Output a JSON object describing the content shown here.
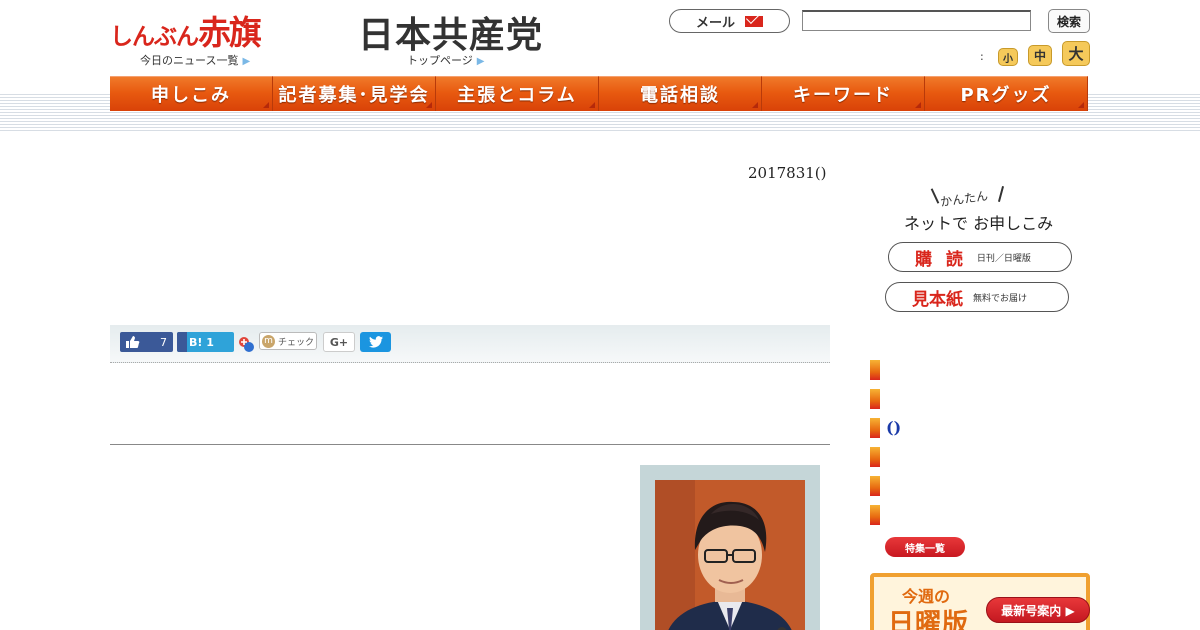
{
  "header": {
    "logo_small": "しんぶん",
    "logo_big": "赤旗",
    "party_logo": "日本共産党",
    "today_news_link": "今日のニュース一覧",
    "top_page_link": "トップページ",
    "mail_button": "メール",
    "search_input_value": "",
    "search_button": "検索",
    "font_size_label": ":",
    "font_small": "小",
    "font_medium": "中",
    "font_large": "大"
  },
  "nav": {
    "items": [
      "申しこみ",
      "記者募集･見学会",
      "主張とコラム",
      "電話相談",
      "キーワード",
      "PRグッズ"
    ]
  },
  "article": {
    "date": "2017831()"
  },
  "share": {
    "like_count": "7",
    "hatena_label": "B!",
    "hatena_count": "1",
    "mixi_label": "チェック",
    "gplus_label": "G+"
  },
  "sidebar": {
    "kantan": "かんたん",
    "net_signup": "ネットで お申しこみ",
    "subscribe_big": "購 読",
    "subscribe_sub": "日刊／日曜版",
    "sample_big": "見本紙",
    "sample_sub": "無料でお届け",
    "list_items": [
      "",
      "",
      "()",
      "",
      "",
      ""
    ],
    "features_button": "特集一覧",
    "sunday_week": "今週の",
    "sunday_title": "日曜版",
    "latest_button": "最新号案内 ▶"
  },
  "colors": {
    "brand_red": "#d9261c",
    "nav_orange": "#e85a10",
    "facebook": "#3b5998",
    "twitter": "#1b95e0"
  }
}
